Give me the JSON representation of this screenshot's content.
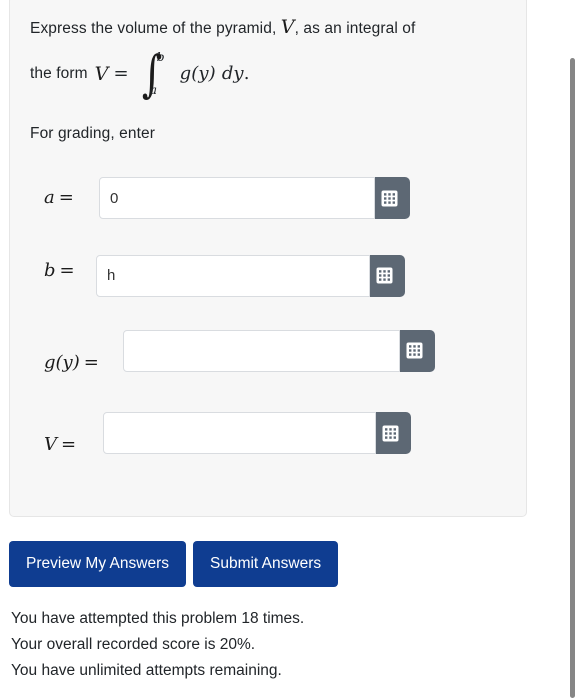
{
  "problem": {
    "statement_part1": "Express the volume of the pyramid, ",
    "statement_var": "V",
    "statement_part2": ", as an integral of",
    "statement_line2_lead": "the form ",
    "formula": {
      "lhs_var": "V",
      "equals": "=",
      "integral_symbol": "∫",
      "upper_limit": "b",
      "lower_limit": "a",
      "integrand": "g(y)",
      "differential": "dy",
      "trailing_period": "."
    },
    "grading_instruction": "For grading, enter"
  },
  "answers": [
    {
      "id": "a",
      "label_var": "a",
      "label_equals": "=",
      "value": "0",
      "placeholder": "",
      "keypad_icon": "math-keypad-icon"
    },
    {
      "id": "b",
      "label_var": "b",
      "label_equals": "=",
      "value": "h",
      "placeholder": "",
      "keypad_icon": "math-keypad-icon"
    },
    {
      "id": "g",
      "label_var": "g(y)",
      "label_equals": "=",
      "value": "",
      "placeholder": "",
      "keypad_icon": "math-keypad-icon"
    },
    {
      "id": "V",
      "label_var": "V",
      "label_equals": "=",
      "value": "",
      "placeholder": "",
      "keypad_icon": "math-keypad-icon"
    }
  ],
  "actions": {
    "preview_label": "Preview My Answers",
    "submit_label": "Submit Answers",
    "button_color": "#0f3d91"
  },
  "status": {
    "attempts": "You have attempted this problem 18 times.",
    "score": "Your overall recorded score is 20%.",
    "remaining": "You have unlimited attempts remaining."
  },
  "colors": {
    "panel_background": "#f7f7f7",
    "panel_border": "#e6e6e6",
    "keypad_button": "#5d6874",
    "input_border": "#d9dce0",
    "text": "#212529",
    "scrollbar_thumb": "#868686"
  }
}
